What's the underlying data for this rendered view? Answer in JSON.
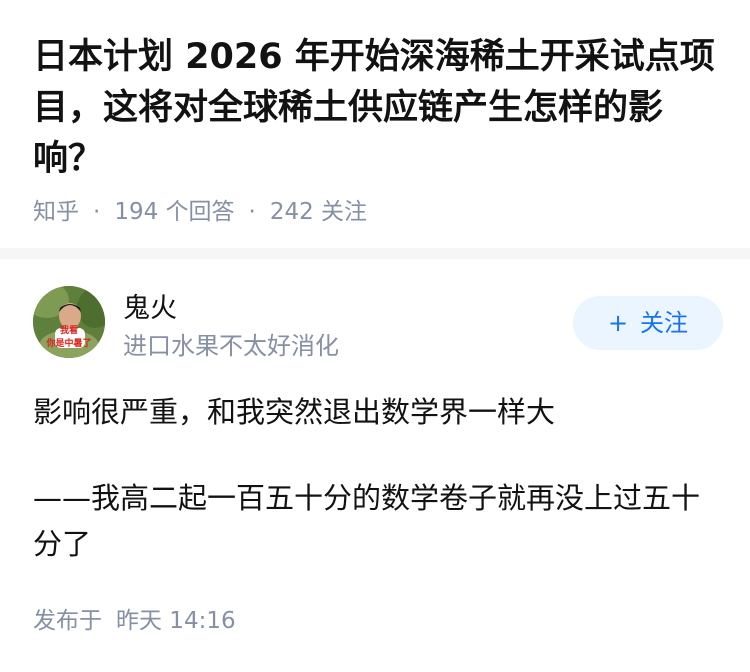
{
  "question": {
    "title": "日本计划 2026 年开始深海稀土开采试点项目，这将对全球稀土供应链产生怎样的影响？",
    "source": "知乎",
    "separator": "·",
    "answers_count": "194 个回答",
    "followers_count": "242 关注"
  },
  "answer": {
    "author": {
      "name": "鬼火",
      "bio": "进口水果不太好消化",
      "avatar_caption_line1": "我看",
      "avatar_caption_line2": "你是中暑了"
    },
    "follow_button": {
      "icon": "+",
      "label": "关注"
    },
    "paragraphs": [
      "影响很严重，和我突然退出数学界一样大",
      "——我高二起一百五十分的数学卷子就再没上过五十分了"
    ],
    "published_label": "发布于",
    "published_time": "昨天 14:16"
  },
  "colors": {
    "title": "#121212",
    "meta_gray": "#8590a6",
    "follow_bg": "#ebf5ff",
    "follow_text": "#1772f6",
    "divider": "#f6f6f6"
  }
}
